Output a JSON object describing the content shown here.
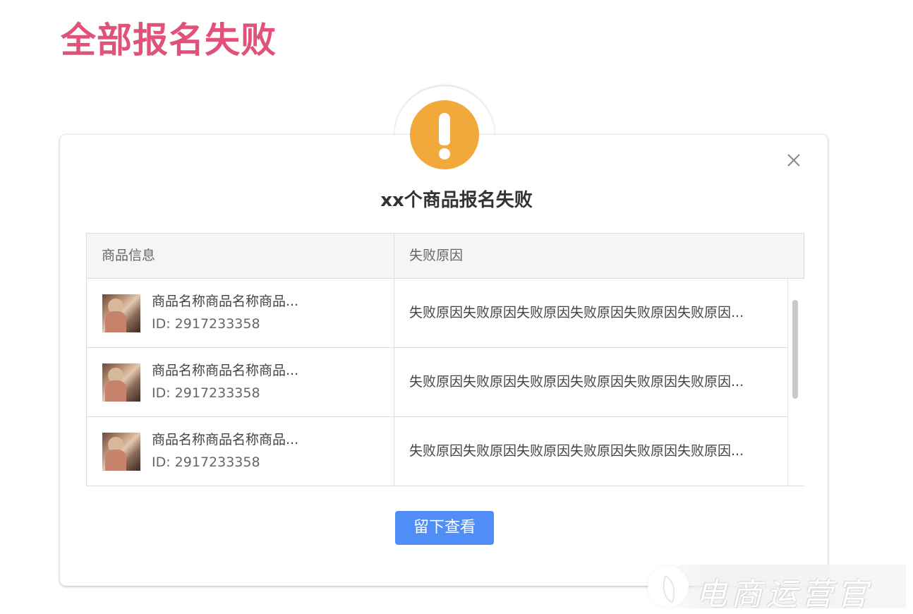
{
  "page": {
    "title": "全部报名失败"
  },
  "dialog": {
    "title": "xx个商品报名失败",
    "close_icon": "close-icon",
    "alert_icon": "exclamation-icon",
    "columns": [
      "商品信息",
      "失败原因"
    ],
    "rows": [
      {
        "name": "商品名称商品名称商品...",
        "id": "ID: 2917233358",
        "reason": "失败原因失败原因失败原因失败原因失败原因失败原因..."
      },
      {
        "name": "商品名称商品名称商品...",
        "id": "ID: 2917233358",
        "reason": "失败原因失败原因失败原因失败原因失败原因失败原因..."
      },
      {
        "name": "商品名称商品名称商品...",
        "id": "ID: 2917233358",
        "reason": "失败原因失败原因失败原因失败原因失败原因失败原因..."
      }
    ],
    "button_label": "留下查看"
  },
  "watermark": {
    "text": "电商运营官"
  },
  "colors": {
    "title": "#e0527a",
    "alert": "#f1a93b",
    "primary_button": "#4f8ef7"
  }
}
